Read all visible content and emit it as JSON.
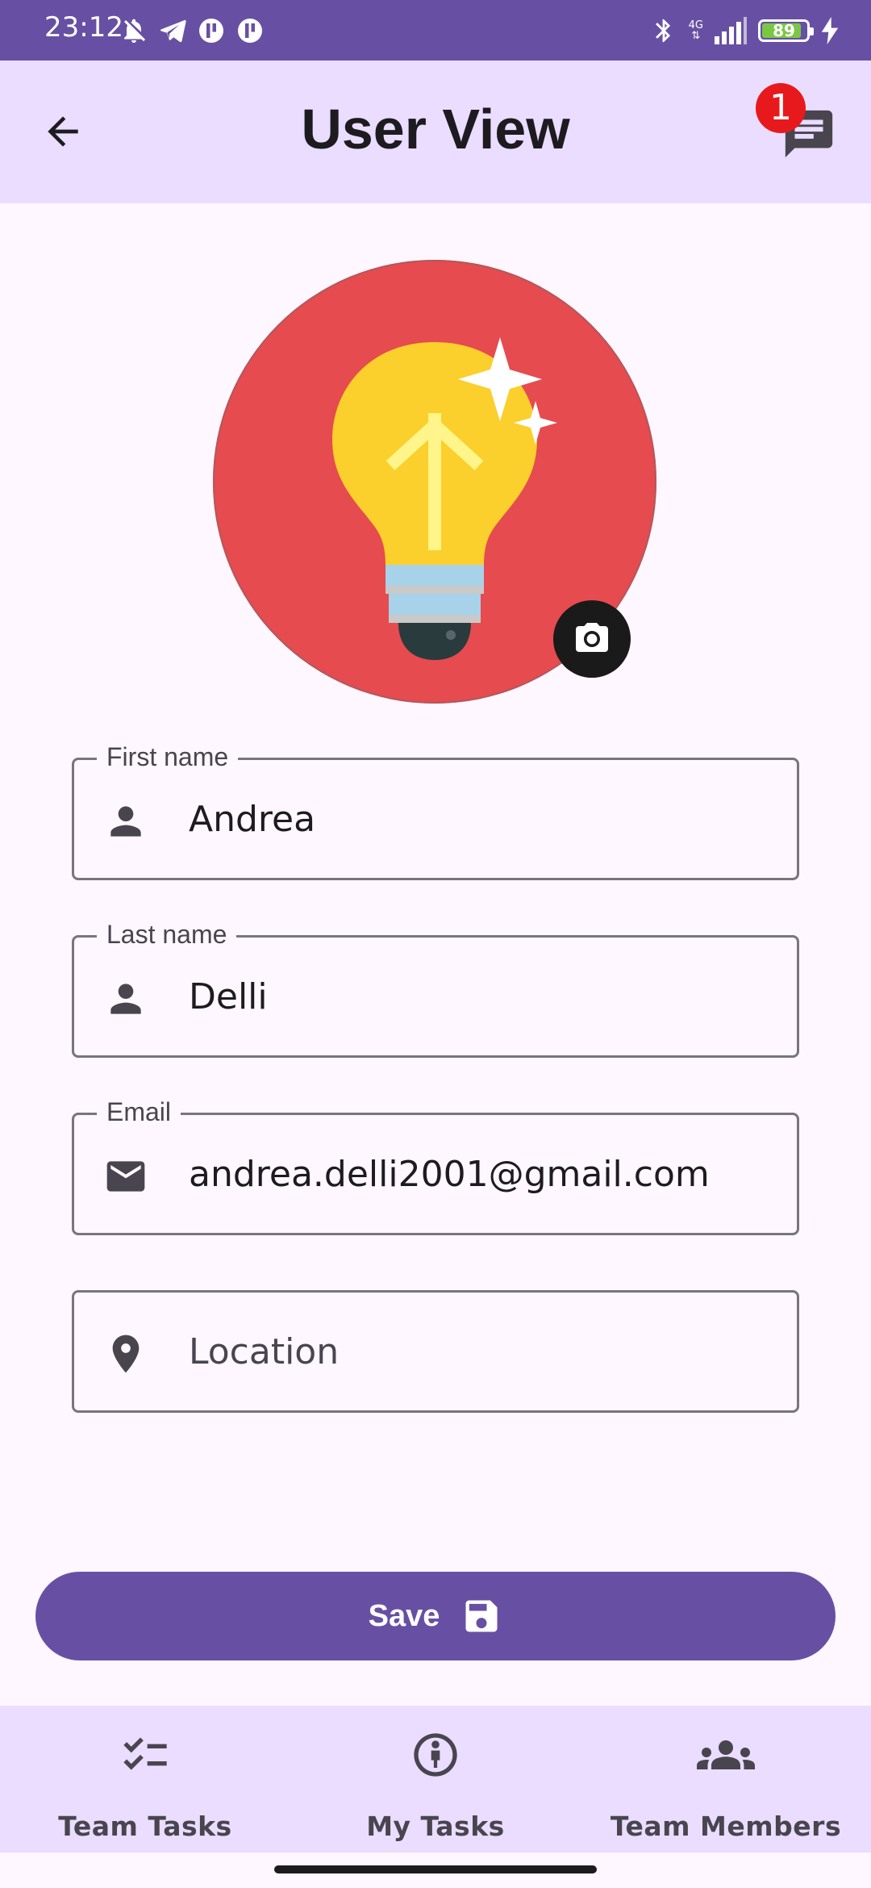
{
  "status_bar": {
    "time": "23:12",
    "battery_level": "89",
    "network_label": "4G",
    "battery_fraction": 0.89
  },
  "app_bar": {
    "title": "User View",
    "back_icon": "arrow-back-icon",
    "chat_icon": "chat-icon",
    "chat_badge_count": "1"
  },
  "profile": {
    "avatar_icon": "lightbulb-icon",
    "camera_icon": "camera-icon"
  },
  "form": {
    "first_name": {
      "label": "First name",
      "value": "Andrea",
      "icon": "person-icon"
    },
    "last_name": {
      "label": "Last name",
      "value": "Delli",
      "icon": "person-icon"
    },
    "email": {
      "label": "Email",
      "value": "andrea.delli2001@gmail.com",
      "icon": "mail-icon"
    },
    "location": {
      "placeholder": "Location",
      "value": "",
      "icon": "location-pin-icon"
    }
  },
  "save_button": {
    "label": "Save",
    "icon": "floppy-disk-icon"
  },
  "bottom_nav": {
    "items": [
      {
        "label": "Team Tasks",
        "icon": "checklist-icon"
      },
      {
        "label": "My Tasks",
        "icon": "person-circle-icon"
      },
      {
        "label": "Team Members",
        "icon": "group-icon"
      }
    ]
  },
  "colors": {
    "primary": "#6750a4",
    "surface_container": "#eaddff",
    "background": "#fef7ff",
    "badge": "#e8191c",
    "avatar_bg": "#e54b4f"
  }
}
